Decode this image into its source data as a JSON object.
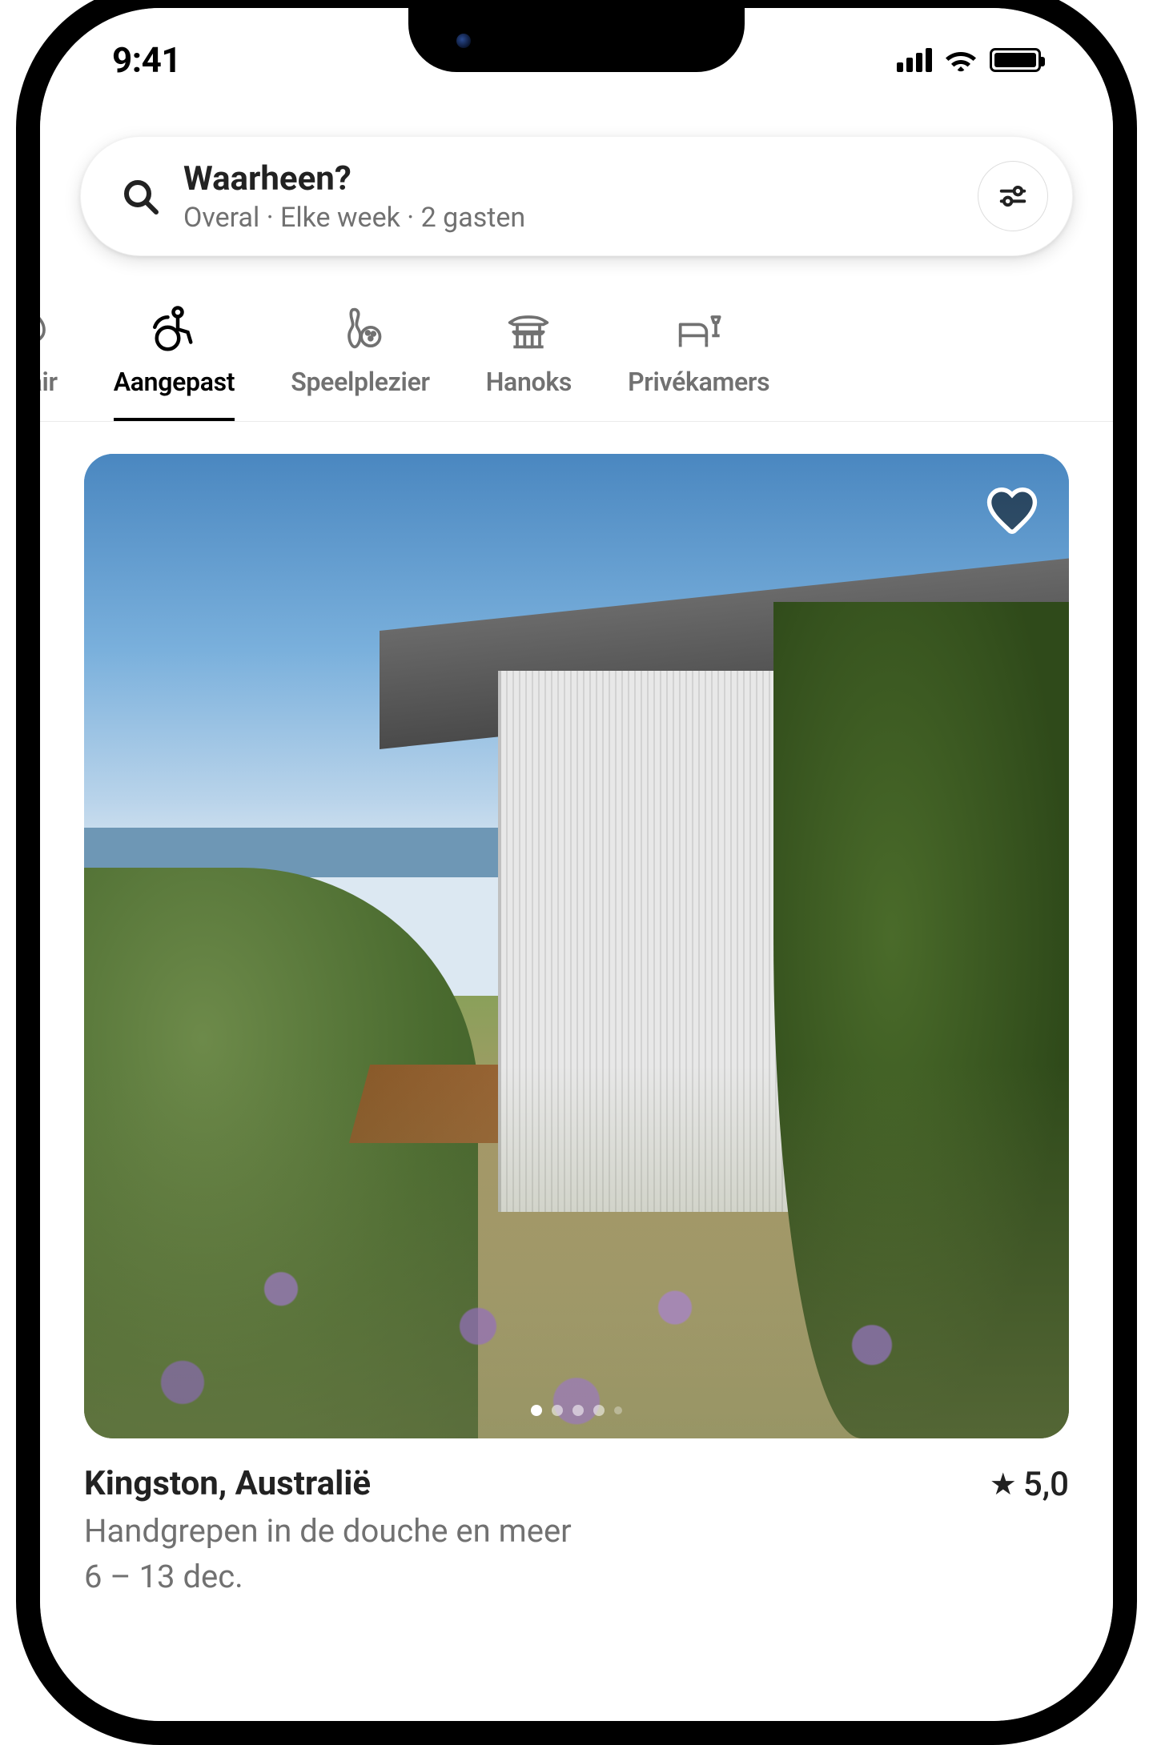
{
  "status": {
    "time": "9:41"
  },
  "search": {
    "title": "Waarheen?",
    "subtitle": "Overal · Elke week · 2 gasten"
  },
  "categories": [
    {
      "label": "ulair",
      "active": false
    },
    {
      "label": "Aangepast",
      "active": true
    },
    {
      "label": "Speelplezier",
      "active": false
    },
    {
      "label": "Hanoks",
      "active": false
    },
    {
      "label": "Privékamers",
      "active": false
    }
  ],
  "listing": {
    "title": "Kingston, Australië",
    "rating": "5,0",
    "subtitle": "Handgrepen in de douche en meer",
    "dates": "6 – 13 dec.",
    "image_dots_count": 5,
    "image_dot_active": 0
  }
}
